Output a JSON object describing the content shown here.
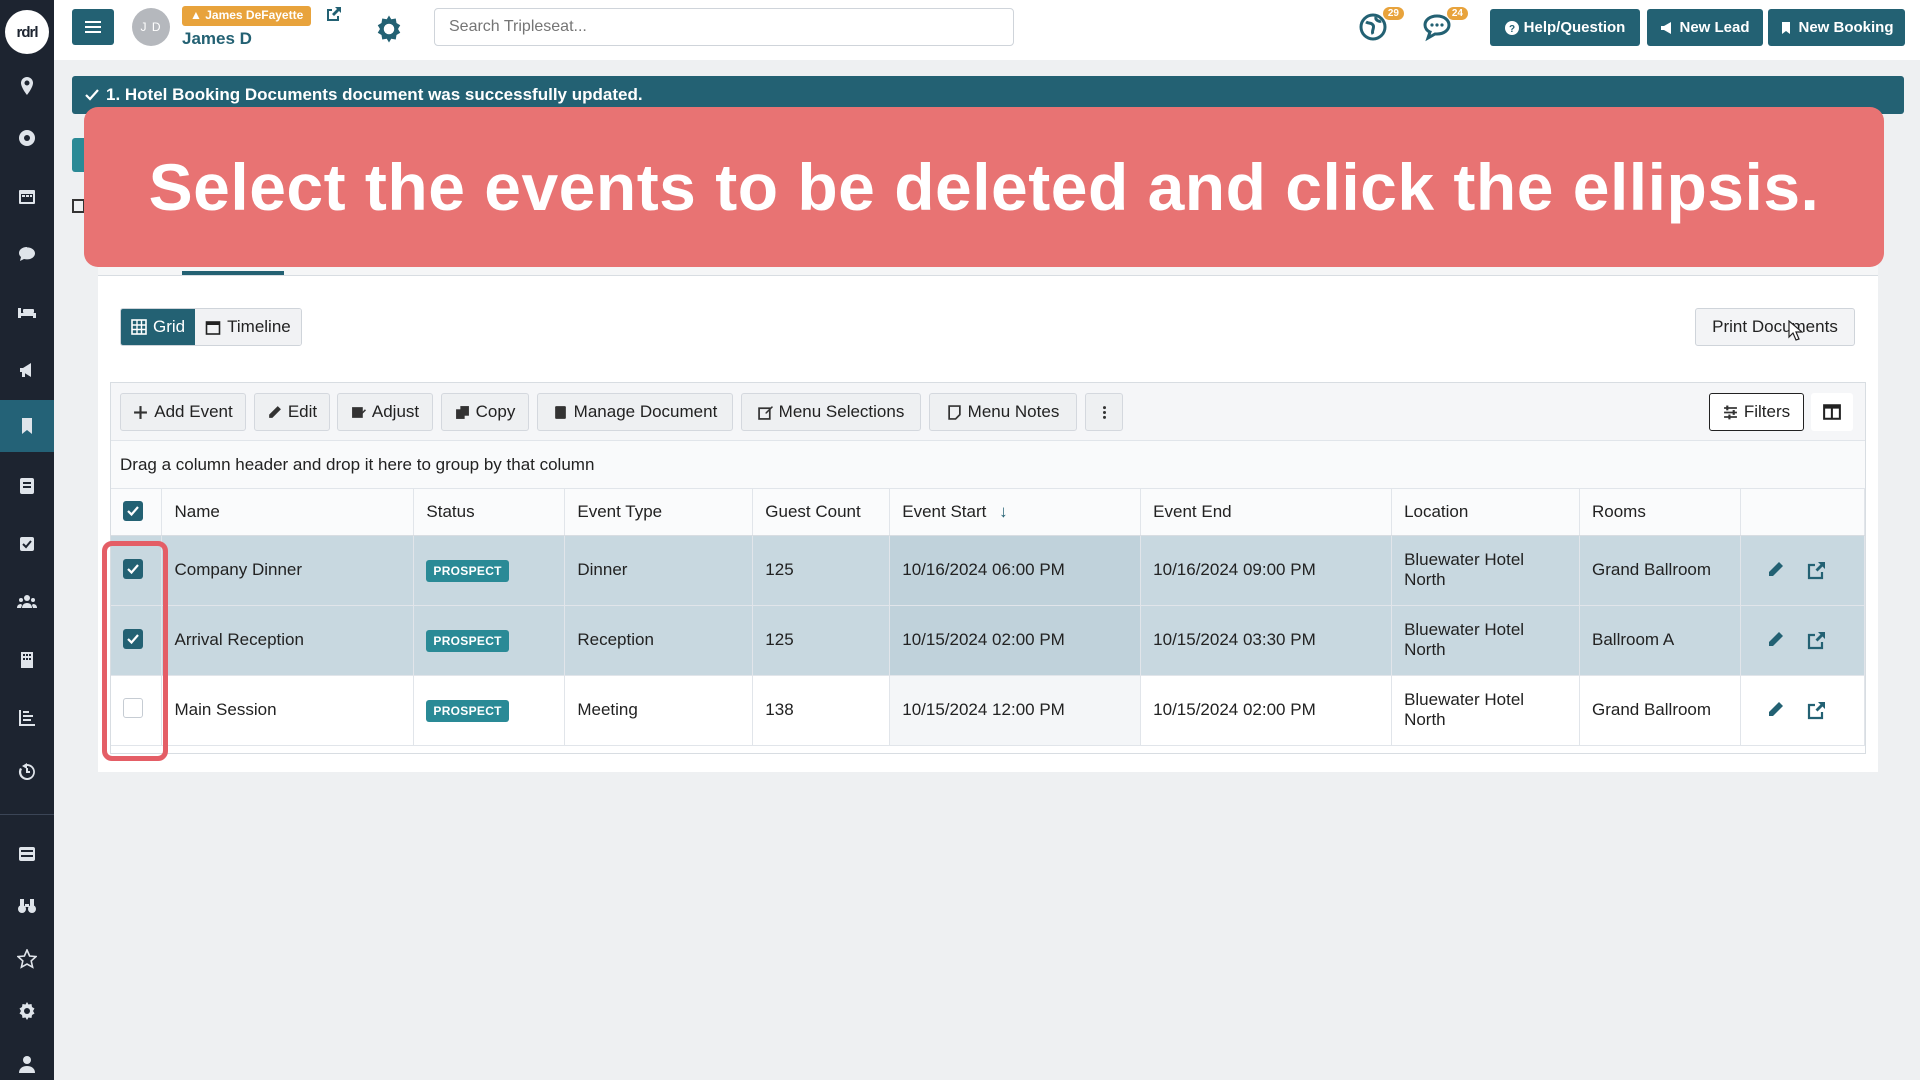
{
  "sidebar": {
    "logo_text": "rdrl",
    "icons": [
      "map-pin-icon",
      "dashboard-icon",
      "calendar-icon",
      "chat-icon",
      "bed-icon",
      "megaphone-icon",
      "bookmark-icon",
      "document-icon",
      "checklist-icon",
      "users-icon",
      "building-icon",
      "reports-icon",
      "history-icon",
      "inbox-icon",
      "binoculars-icon",
      "star-icon",
      "gear-icon",
      "person-icon"
    ],
    "active_index": 6
  },
  "topbar": {
    "avatar_initials": "J D",
    "user_tag": "James DeFayette",
    "user_name": "James D",
    "search_placeholder": "Search Tripleseat...",
    "notif_globe_count": "29",
    "notif_chat_count": "24",
    "help_label": "Help/Question",
    "new_lead_label": "New Lead",
    "new_booking_label": "New Booking"
  },
  "alert": {
    "message": "1. Hotel Booking Documents document was successfully updated."
  },
  "banner": {
    "text": "Select the events to be deleted and click the ellipsis."
  },
  "view": {
    "grid_label": "Grid",
    "timeline_label": "Timeline",
    "print_label": "Print Documents"
  },
  "toolbar": {
    "add_event": "Add Event",
    "edit": "Edit",
    "adjust": "Adjust",
    "copy": "Copy",
    "manage_document": "Manage Document",
    "menu_selections": "Menu Selections",
    "menu_notes": "Menu Notes",
    "filters": "Filters"
  },
  "grid": {
    "group_hint": "Drag a column header and drop it here to group by that column",
    "headers": {
      "name": "Name",
      "status": "Status",
      "event_type": "Event Type",
      "guest_count": "Guest Count",
      "event_start": "Event Start",
      "event_end": "Event End",
      "location": "Location",
      "rooms": "Rooms"
    },
    "rows": [
      {
        "selected": true,
        "name": "Company Dinner",
        "status": "PROSPECT",
        "event_type": "Dinner",
        "guest_count": "125",
        "event_start": "10/16/2024 06:00 PM",
        "event_end": "10/16/2024 09:00 PM",
        "location_line1": "Bluewater Hotel",
        "location_line2": "North",
        "rooms": "Grand Ballroom"
      },
      {
        "selected": true,
        "name": "Arrival Reception",
        "status": "PROSPECT",
        "event_type": "Reception",
        "guest_count": "125",
        "event_start": "10/15/2024 02:00 PM",
        "event_end": "10/15/2024 03:30 PM",
        "location_line1": "Bluewater Hotel",
        "location_line2": "North",
        "rooms": "Ballroom A"
      },
      {
        "selected": false,
        "name": "Main Session",
        "status": "PROSPECT",
        "event_type": "Meeting",
        "guest_count": "138",
        "event_start": "10/15/2024 12:00 PM",
        "event_end": "10/15/2024 02:00 PM",
        "location_line1": "Bluewater Hotel",
        "location_line2": "North",
        "rooms": "Grand Ballroom"
      }
    ]
  },
  "colors": {
    "brand": "#236173",
    "banner": "#e87373",
    "badge": "#e8a33c",
    "status": "#2a8a96"
  }
}
